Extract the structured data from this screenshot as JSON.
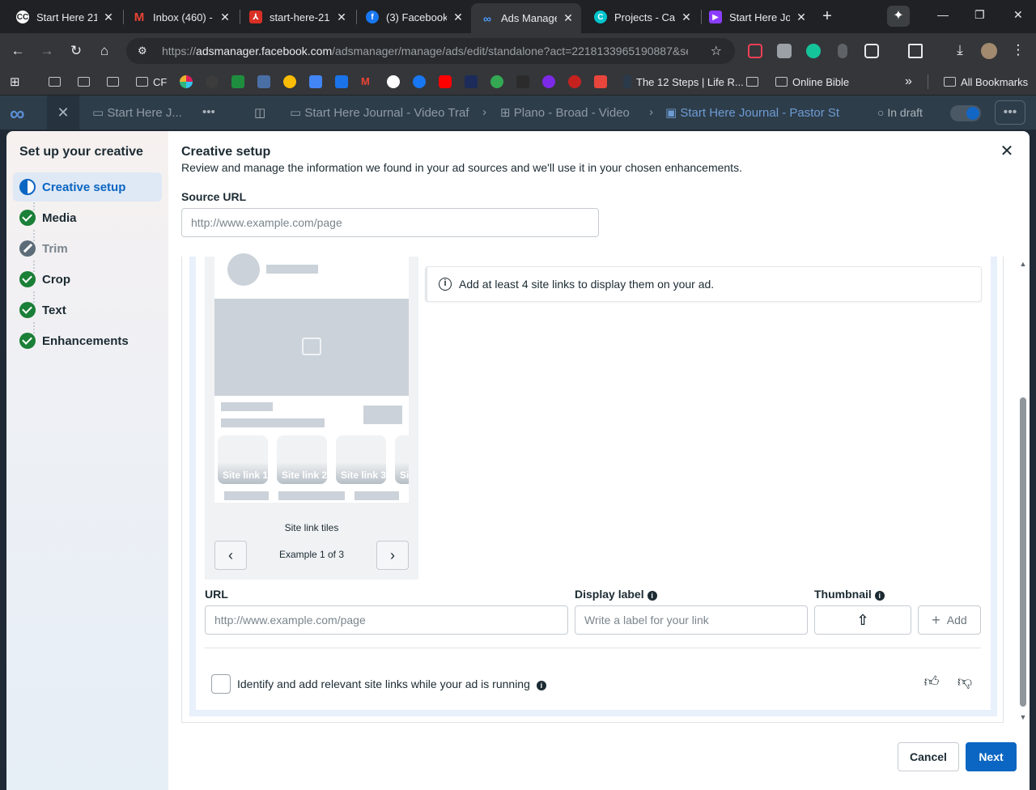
{
  "browser": {
    "tabs": [
      {
        "title": "Start Here 21",
        "icon_color": "#202124",
        "icon": "cc-icon"
      },
      {
        "title": "Inbox (460) -",
        "icon_color": "#ea4335",
        "icon": "gmail-icon"
      },
      {
        "title": "start-here-21",
        "icon_color": "#d93025",
        "icon": "pdf-icon"
      },
      {
        "title": "(3) Facebook",
        "icon_color": "#1877f2",
        "icon": "facebook-icon"
      },
      {
        "title": "Ads Manager",
        "icon_color": "#0668e1",
        "icon": "meta-icon"
      },
      {
        "title": "Projects - Can",
        "icon_color": "#00c4cc",
        "icon": "canva-icon"
      },
      {
        "title": "Start Here Jou",
        "icon_color": "#8b3dff",
        "icon": "video-icon"
      }
    ],
    "url_prefix": "https://",
    "url_host": "adsmanager.facebook.com",
    "url_path": "/adsmanager/manage/ads/edit/standalone?act=2218133965190887&se...",
    "bookmarks": [
      {
        "label": "CF"
      },
      {
        "label": "The 12 Steps | Life R..."
      },
      {
        "label": "Online Bible"
      },
      {
        "label": "All Bookmarks"
      }
    ]
  },
  "app": {
    "campaign_tab": "Start Here J...",
    "breadcrumbs": [
      "Start Here Journal - Video Traf",
      "Plano - Broad - Video",
      "Start Here Journal - Pastor St"
    ],
    "status": "In draft"
  },
  "sidebar": {
    "title": "Set up your creative",
    "steps": [
      {
        "label": "Creative setup",
        "state": "active"
      },
      {
        "label": "Media",
        "state": "done"
      },
      {
        "label": "Trim",
        "state": "disabled"
      },
      {
        "label": "Crop",
        "state": "done"
      },
      {
        "label": "Text",
        "state": "done"
      },
      {
        "label": "Enhancements",
        "state": "done"
      }
    ]
  },
  "main": {
    "title": "Creative setup",
    "subtitle": "Review and manage the information we found in your ad sources and we'll use it in your chosen enhancements.",
    "source_url_label": "Source URL",
    "source_url_placeholder": "http://www.example.com/page",
    "preview": {
      "site_links": [
        "Site link 1",
        "Site link 2",
        "Site link 3",
        "Si"
      ],
      "caption": "Site link tiles",
      "pager": "Example 1 of 3"
    },
    "info_message": "Add at least 4 site links to display them on your ad.",
    "url_label": "URL",
    "url_placeholder": "http://www.example.com/page",
    "display_label": "Display label",
    "display_placeholder": "Write a label for your link",
    "thumbnail_label": "Thumbnail",
    "add_label": "Add",
    "auto_sitelinks_label": "Identify and add relevant site links while your ad is running"
  },
  "footer": {
    "cancel": "Cancel",
    "next": "Next"
  },
  "colors": {
    "primary": "#0a66c2",
    "done": "#1a7f37"
  }
}
